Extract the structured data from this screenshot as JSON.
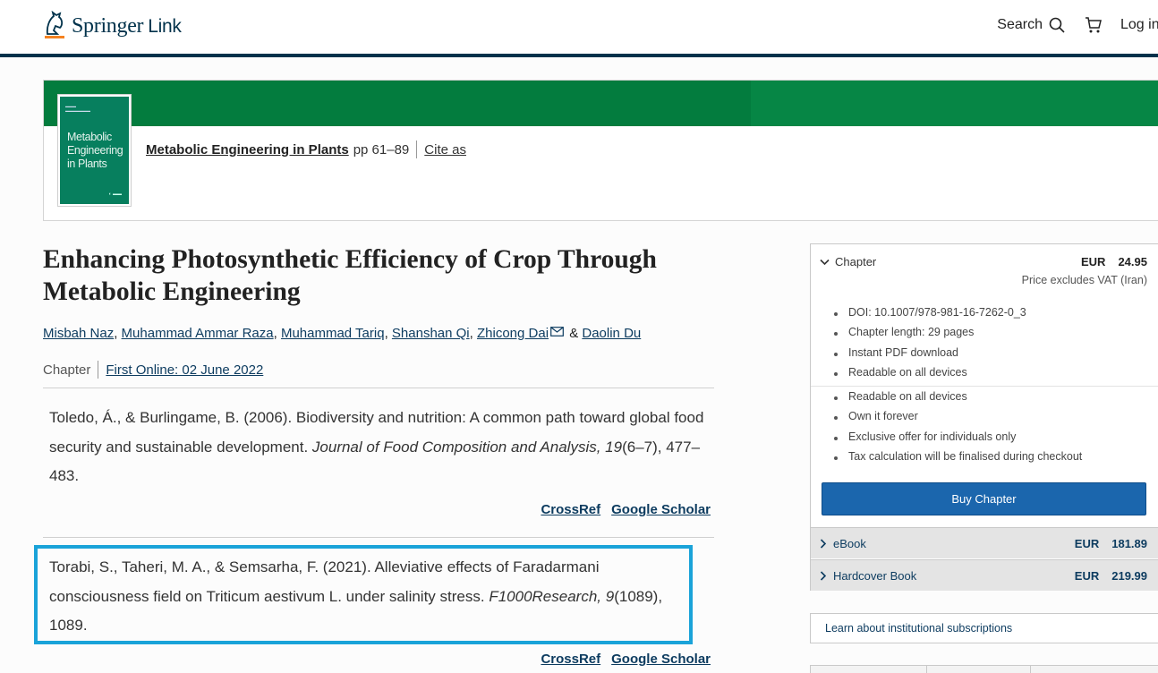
{
  "header": {
    "logo_springer": "Springer",
    "logo_link": "Link",
    "search_label": "Search",
    "login_label": "Log in"
  },
  "book": {
    "cover_title": "Metabolic Engineering in Plants",
    "title": "Metabolic Engineering in Plants",
    "pages": "pp 61–89",
    "cite_label": "Cite as"
  },
  "article": {
    "title": "Enhancing Photosynthetic Efficiency of Crop Through Metabolic Engineering",
    "authors": [
      "Misbah Naz",
      "Muhammad Ammar Raza",
      "Muhammad Tariq",
      "Shanshan Qi",
      "Zhicong Dai",
      "Daolin Du"
    ],
    "type": "Chapter",
    "first_online": "First Online: 02 June 2022"
  },
  "references": [
    {
      "text_a": "Toledo, Á., & Burlingame, B. (2006). Biodiversity and nutrition: A common path toward global food security and sustainable development. ",
      "journal": "Journal of Food Composition and Analysis, 19",
      "text_b": "(6–7), 477–483.",
      "crossref": "CrossRef",
      "scholar": "Google Scholar"
    },
    {
      "text_a": "Torabi, S., Taheri, M. A., & Semsarha, F. (2021). Alleviative effects of Faradarmani consciousness field on Triticum aestivum L. under salinity stress. ",
      "journal": "F1000Research, 9",
      "text_b": "(1089), 1089.",
      "crossref": "CrossRef",
      "scholar": "Google Scholar"
    }
  ],
  "sidebar": {
    "chapter_label": "Chapter",
    "currency": "EUR",
    "chapter_price": "24.95",
    "vat_note": "Price excludes VAT (Iran)",
    "features": [
      "DOI: 10.1007/978-981-16-7262-0_3",
      "Chapter length: 29 pages",
      "Instant PDF download",
      "Readable on all devices"
    ],
    "benefits": [
      "Readable on all devices",
      "Own it forever",
      "Exclusive offer for individuals only",
      "Tax calculation will be finalised during checkout"
    ],
    "buy_label": "Buy Chapter",
    "options": [
      {
        "label": "eBook",
        "currency": "EUR",
        "price": "181.89"
      },
      {
        "label": "Hardcover Book",
        "currency": "EUR",
        "price": "219.99"
      }
    ],
    "institutional": "Learn about institutional subscriptions"
  },
  "colors": {
    "brand_navy": "#01324b",
    "banner_green": "#068645",
    "highlight": "#1aa3d9",
    "buy_button": "#1b66ad"
  }
}
